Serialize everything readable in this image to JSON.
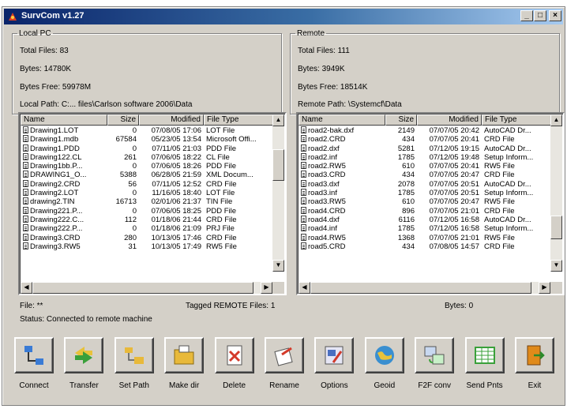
{
  "window": {
    "title": "SurvCom v1.27"
  },
  "local": {
    "legend": "Local PC",
    "total_files": "Total Files: 83",
    "bytes": "Bytes: 14780K",
    "bytes_free": "Bytes Free: 59978M",
    "path": "Local Path: C:... files\\Carlson software 2006\\Data",
    "columns": [
      "Name",
      "Size",
      "Modified",
      "File Type"
    ],
    "rows": [
      [
        "Drawing1.LOT",
        "0",
        "07/08/05 17:06",
        "LOT File"
      ],
      [
        "Drawing1.mdb",
        "67584",
        "05/23/05 13:54",
        "Microsoft Offi..."
      ],
      [
        "Drawing1.PDD",
        "0",
        "07/11/05 21:03",
        "PDD File"
      ],
      [
        "Drawing122.CL",
        "261",
        "07/06/05 18:22",
        "CL File"
      ],
      [
        "Drawing1bb.P...",
        "0",
        "07/06/05 18:26",
        "PDD File"
      ],
      [
        "DRAWING1_O...",
        "5388",
        "06/28/05 21:59",
        "XML Docum..."
      ],
      [
        "Drawing2.CRD",
        "56",
        "07/11/05 12:52",
        "CRD File"
      ],
      [
        "Drawing2.LOT",
        "0",
        "11/16/05 18:40",
        "LOT File"
      ],
      [
        "drawing2.TIN",
        "16713",
        "02/01/06 21:37",
        "TIN File"
      ],
      [
        "Drawing221.P...",
        "0",
        "07/06/05 18:25",
        "PDD File"
      ],
      [
        "Drawing222.C...",
        "112",
        "01/18/06 21:44",
        "CRD File"
      ],
      [
        "Drawing222.P...",
        "0",
        "01/18/06 21:09",
        "PRJ File"
      ],
      [
        "Drawing3.CRD",
        "280",
        "10/13/05 17:46",
        "CRD File"
      ],
      [
        "Drawing3.RW5",
        "31",
        "10/13/05 17:49",
        "RW5 File"
      ]
    ]
  },
  "remote": {
    "legend": "Remote",
    "total_files": "Total Files: 111",
    "bytes": "Bytes: 3949K",
    "bytes_free": "Bytes Free: 18514K",
    "path": "Remote Path: \\Systemcf\\Data",
    "columns": [
      "Name",
      "Size",
      "Modified",
      "File Type"
    ],
    "rows": [
      [
        "road2-bak.dxf",
        "2149",
        "07/07/05 20:42",
        "AutoCAD Dr..."
      ],
      [
        "road2.CRD",
        "434",
        "07/07/05 20:41",
        "CRD File"
      ],
      [
        "road2.dxf",
        "5281",
        "07/12/05 19:15",
        "AutoCAD Dr..."
      ],
      [
        "road2.inf",
        "1785",
        "07/12/05 19:48",
        "Setup Inform..."
      ],
      [
        "road2.RW5",
        "610",
        "07/07/05 20:41",
        "RW5 File"
      ],
      [
        "road3.CRD",
        "434",
        "07/07/05 20:47",
        "CRD File"
      ],
      [
        "road3.dxf",
        "2078",
        "07/07/05 20:51",
        "AutoCAD Dr..."
      ],
      [
        "road3.inf",
        "1785",
        "07/07/05 20:51",
        "Setup Inform..."
      ],
      [
        "road3.RW5",
        "610",
        "07/07/05 20:47",
        "RW5 File"
      ],
      [
        "road4.CRD",
        "896",
        "07/07/05 21:01",
        "CRD File"
      ],
      [
        "road4.dxf",
        "6116",
        "07/12/05 16:58",
        "AutoCAD Dr..."
      ],
      [
        "road4.inf",
        "1785",
        "07/12/05 16:58",
        "Setup Inform..."
      ],
      [
        "road4.RW5",
        "1368",
        "07/07/05 21:01",
        "RW5 File"
      ],
      [
        "road5.CRD",
        "434",
        "07/08/05 14:57",
        "CRD File"
      ]
    ]
  },
  "status": {
    "file": "File: **",
    "tagged": "Tagged REMOTE Files: 1",
    "bytes": "Bytes: 0",
    "connection": "Status: Connected to remote machine"
  },
  "toolbar": {
    "buttons": [
      {
        "label": "Connect",
        "icon": "connect-icon",
        "color": "#3a7bd5"
      },
      {
        "label": "Transfer",
        "icon": "transfer-icon",
        "color": "#3aa03a"
      },
      {
        "label": "Set Path",
        "icon": "folder-tree-icon",
        "color": "#e8b93a"
      },
      {
        "label": "Make dir",
        "icon": "folder-icon",
        "color": "#e8b93a"
      },
      {
        "label": "Delete",
        "icon": "delete-icon",
        "color": "#d43a2a"
      },
      {
        "label": "Rename",
        "icon": "rename-icon",
        "color": "#d43a2a"
      },
      {
        "label": "Options",
        "icon": "options-icon",
        "color": "#4a6fc0"
      },
      {
        "label": "Geoid",
        "icon": "globe-icon",
        "color": "#3a8fd0"
      },
      {
        "label": "F2F conv",
        "icon": "convert-icon",
        "color": "#3aa03a"
      },
      {
        "label": "Send Pnts",
        "icon": "spreadsheet-icon",
        "color": "#3aa03a"
      },
      {
        "label": "Exit",
        "icon": "exit-door-icon",
        "color": "#e08a1a"
      }
    ]
  }
}
